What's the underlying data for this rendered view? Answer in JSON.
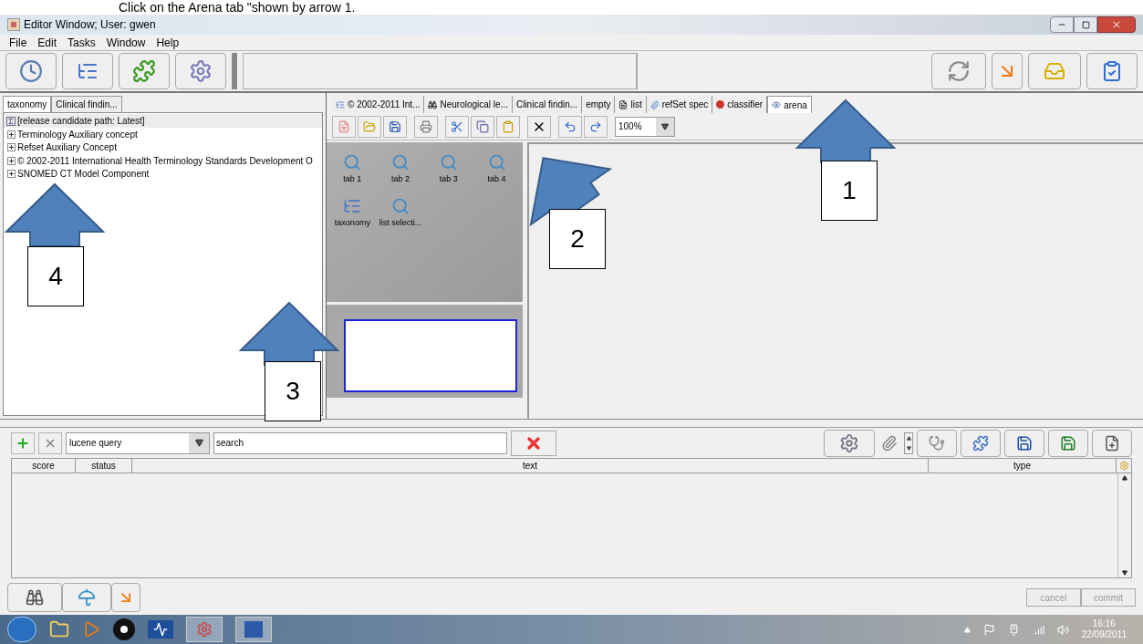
{
  "instruction": "Click on the Arena tab \"shown by arrow 1.",
  "window": {
    "title": "Editor Window; User: gwen"
  },
  "menu": [
    "File",
    "Edit",
    "Tasks",
    "Window",
    "Help"
  ],
  "left_panel": {
    "tabs": [
      {
        "label": "taxonomy",
        "selected": true
      },
      {
        "label": "Clinical findin...",
        "selected": false
      }
    ],
    "tree": {
      "root": {
        "label": "[release candidate path: Latest]",
        "selected": true
      },
      "items": [
        {
          "label": "Terminology Auxiliary concept",
          "expanded": false
        },
        {
          "label": "Refset Auxiliary Concept",
          "expanded": false
        },
        {
          "label": "© 2002-2011 International Health Terminology Standards Development O",
          "expanded": false
        },
        {
          "label": "SNOMED CT Model Component",
          "expanded": false
        }
      ]
    }
  },
  "center_panel": {
    "tabs": [
      {
        "label": "© 2002-2011 Int...",
        "selected": false
      },
      {
        "label": "Neurological le...",
        "selected": false
      },
      {
        "label": "Clinical findin...",
        "selected": false
      },
      {
        "label": "empty",
        "selected": false
      },
      {
        "label": "list",
        "selected": false
      },
      {
        "label": "refSet spec",
        "selected": false
      },
      {
        "label": "classifier",
        "selected": false
      },
      {
        "label": "arena",
        "selected": true
      }
    ],
    "zoom": "100%",
    "palette": [
      {
        "label": "tab 1",
        "kind": "search"
      },
      {
        "label": "tab 2",
        "kind": "search"
      },
      {
        "label": "tab 3",
        "kind": "search"
      },
      {
        "label": "tab 4",
        "kind": "search"
      },
      {
        "label": "taxonomy",
        "kind": "tree"
      },
      {
        "label": "list selecti...",
        "kind": "search"
      }
    ]
  },
  "search_bar": {
    "query_type": "lucene query",
    "search": "search"
  },
  "table": {
    "columns": [
      "score",
      "status",
      "text",
      "type"
    ]
  },
  "footer": {
    "buttons": [
      {
        "label": "cancel",
        "disabled": true
      },
      {
        "label": "commit",
        "disabled": true
      }
    ]
  },
  "taskbar": {
    "time": "16:16",
    "date": "22/09/2011"
  },
  "annotations": [
    {
      "label": "1"
    },
    {
      "label": "2"
    },
    {
      "label": "3"
    },
    {
      "label": "4"
    }
  ]
}
